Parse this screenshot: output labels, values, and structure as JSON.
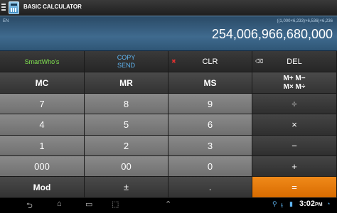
{
  "app": {
    "title": "BASIC CALCULATOR"
  },
  "display": {
    "mode": "EN",
    "expression": "((1,000×6,233)×6,536)×6,236",
    "result": "254,006,966,680,000"
  },
  "row0": [
    "SmartWho's",
    "COPY",
    "SEND",
    "CLR",
    "DEL"
  ],
  "row1": [
    "MC",
    "MR",
    "MS",
    "M+ M−",
    "M× M÷"
  ],
  "row2": [
    "7",
    "8",
    "9",
    "÷"
  ],
  "row3": [
    "4",
    "5",
    "6",
    "×"
  ],
  "row4": [
    "1",
    "2",
    "3",
    "−"
  ],
  "row5": [
    "000",
    "00",
    "0",
    "+"
  ],
  "row6": [
    "Mod",
    "±",
    ".",
    "="
  ],
  "statusbar": {
    "time": "3:02",
    "ampm": "PM"
  },
  "colors": {
    "accent": "#e87800",
    "display": "#3f6a8e",
    "green": "#7fe04f",
    "blue": "#5fb4f0"
  }
}
